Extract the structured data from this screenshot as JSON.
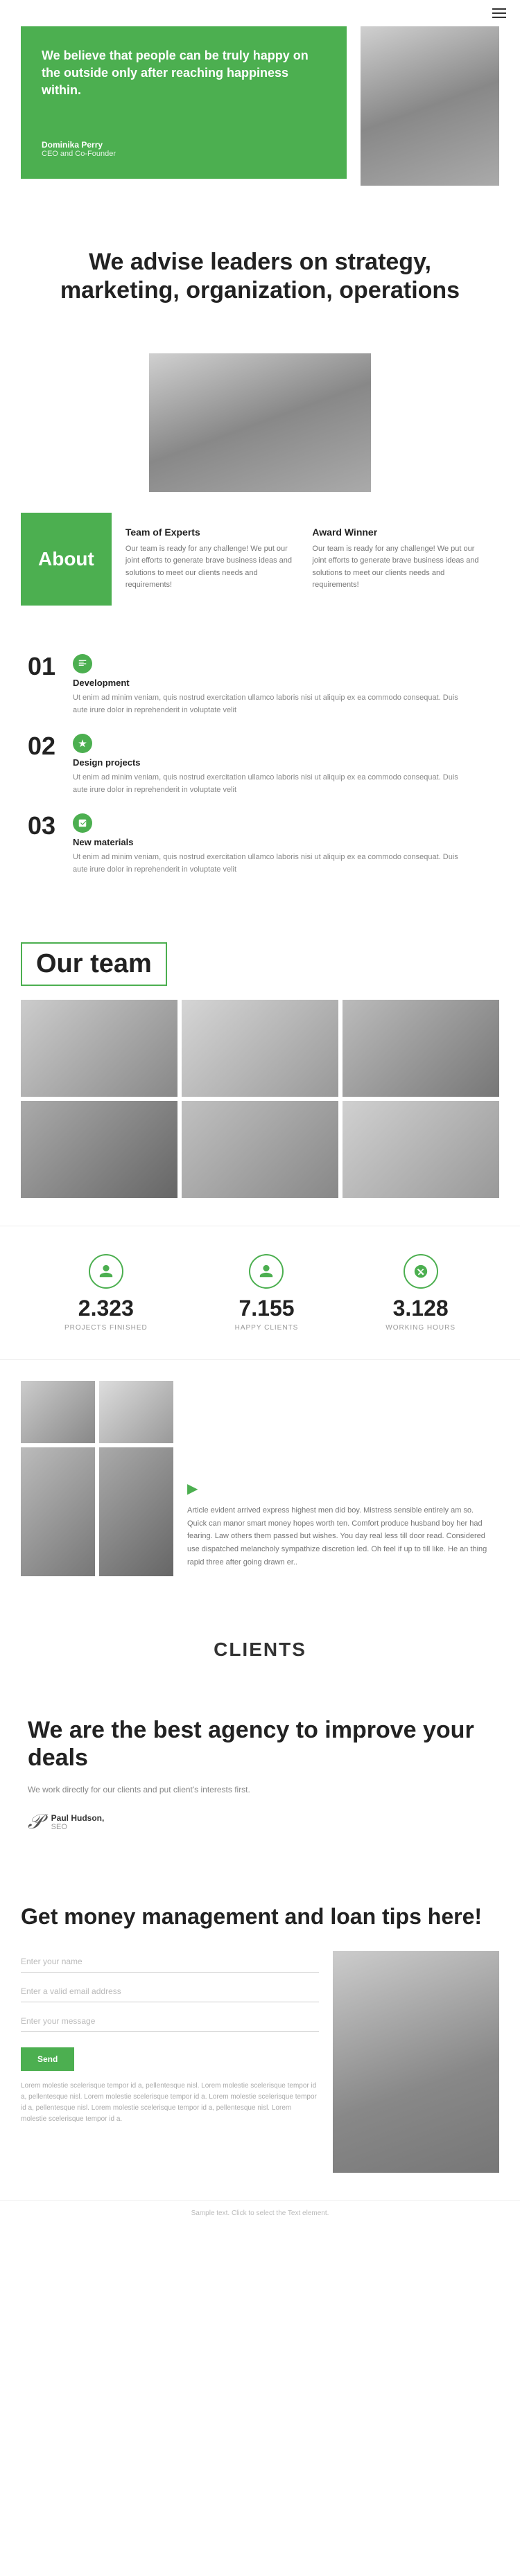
{
  "header": {
    "menu_icon_label": "Menu"
  },
  "hero": {
    "quote": "We believe that people can be truly happy on the outside only after reaching happiness within.",
    "author_name": "Dominika Perry",
    "author_title": "CEO and Co-Founder"
  },
  "strategy": {
    "title": "We advise leaders on strategy, marketing, organization, operations"
  },
  "about": {
    "label": "About",
    "col1_title": "Team of Experts",
    "col1_text": "Our team is ready for any challenge! We put our joint efforts to generate brave business ideas and solutions to meet our clients needs and requirements!",
    "col2_title": "Award Winner",
    "col2_text": "Our team is ready for any challenge! We put our joint efforts to generate brave business ideas and solutions to meet our clients needs and requirements!"
  },
  "steps": [
    {
      "number": "01",
      "title": "Development",
      "text": "Ut enim ad minim veniam, quis nostrud exercitation ullamco laboris nisi ut aliquip ex ea commodo consequat. Duis aute irure dolor in reprehenderit in voluptate velit"
    },
    {
      "number": "02",
      "title": "Design projects",
      "text": "Ut enim ad minim veniam, quis nostrud exercitation ullamco laboris nisi ut aliquip ex ea commodo consequat. Duis aute irure dolor in reprehenderit in voluptate velit"
    },
    {
      "number": "03",
      "title": "New materials",
      "text": "Ut enim ad minim veniam, quis nostrud exercitation ullamco laboris nisi ut aliquip ex ea commodo consequat. Duis aute irure dolor in reprehenderit in voluptate velit"
    }
  ],
  "team": {
    "title": "Our team",
    "photos": [
      "Photo 1",
      "Photo 2",
      "Photo 3",
      "Photo 4",
      "Photo 5",
      "Photo 6"
    ]
  },
  "stats": [
    {
      "number": "2.323",
      "label": "PROJECTS FINISHED",
      "icon": "person-icon"
    },
    {
      "number": "7.155",
      "label": "HAPPY CLIENTS",
      "icon": "person-icon"
    },
    {
      "number": "3.128",
      "label": "WORKING HOURS",
      "icon": "gear-icon"
    }
  ],
  "gallery": {
    "text": "Article evident arrived express highest men did boy. Mistress sensible entirely am so. Quick can manor smart money hopes worth ten. Comfort produce husband boy her had fearing. Law others them passed but wishes. You day real less till door read. Considered use dispatched melancholy sympathize discretion led. Oh feel if up to till like. He an thing rapid three after going drawn er.."
  },
  "clients": {
    "label": "CLIENTS"
  },
  "agency": {
    "title": "We are the best agency to improve your deals",
    "text": "We work directly for our clients and put client's interests first.",
    "author_name": "Paul Hudson,",
    "author_title": "SEO"
  },
  "loan": {
    "title": "Get money management and loan tips here!",
    "form": {
      "name_placeholder": "Enter your name",
      "email_placeholder": "Enter a valid email address",
      "message_placeholder": "Enter your message",
      "submit_label": "Send",
      "disclaimer": "Lorem molestie scelerisque tempor id a, pellentesque nisl. Lorem molestie scelerisque tempor id a, pellentesque nisl. Lorem molestie scelerisque tempor id a. Lorem molestie scelerisque tempor id a, pellentesque nisl. Lorem molestie scelerisque tempor id a, pellentesque nisl. Lorem molestie scelerisque tempor id a."
    }
  },
  "footer": {
    "hint": "Sample text. Click to select the Text element."
  },
  "colors": {
    "green": "#4caf50",
    "dark": "#222222",
    "gray_text": "#888888",
    "light_border": "#eeeeee"
  }
}
